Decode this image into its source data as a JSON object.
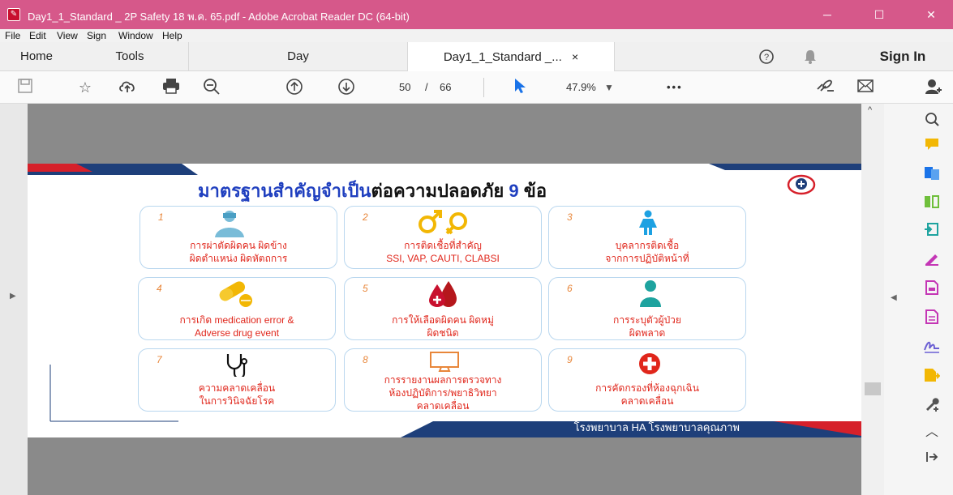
{
  "window": {
    "title": "Day1_1_Standard _ 2P Safety 18 พ.ค. 65.pdf - Adobe Acrobat Reader DC (64-bit)",
    "app_icon": "acrobat-icon",
    "controls": {
      "minimize": "─",
      "maximize": "☐",
      "close": "✕"
    }
  },
  "menu": [
    "File",
    "Edit",
    "View",
    "Sign",
    "Window",
    "Help"
  ],
  "tabs": {
    "home": "Home",
    "tools": "Tools",
    "doc1": "Day",
    "doc2": "Day1_1_Standard _...",
    "close": "×",
    "sign_in": "Sign In"
  },
  "toolbar": {
    "page_current": "50",
    "page_sep": "/",
    "page_total": "66",
    "zoom": "47.9%",
    "more": "•••"
  },
  "slide": {
    "title_blue": "มาตรฐานสำคัญจำเป็น",
    "title_black": "ต่อความปลอดภัย",
    "title_num": "9",
    "title_end": "ข้อ",
    "footer": "โรงพยาบาล HA โรงพยาบาลคุณภาพ",
    "cards": [
      {
        "num": "1",
        "line1": "การผ่าตัดผิดคน ผิดข้าง",
        "line2": "ผิดตำแหน่ง ผิดหัตถการ",
        "line3": ""
      },
      {
        "num": "2",
        "line1": "การติดเชื้อที่สำคัญ",
        "line2": "SSI, VAP, CAUTI, CLABSI",
        "line3": ""
      },
      {
        "num": "3",
        "line1": "บุคลากรติดเชื้อ",
        "line2": "จากการปฏิบัติหน้าที่",
        "line3": ""
      },
      {
        "num": "4",
        "line1": "การเกิด medication error &",
        "line2": "Adverse drug event",
        "line3": ""
      },
      {
        "num": "5",
        "line1": "การให้เลือดผิดคน ผิดหมู่",
        "line2": "ผิดชนิด",
        "line3": ""
      },
      {
        "num": "6",
        "line1": "การระบุตัวผู้ป่วย",
        "line2": "ผิดพลาด",
        "line3": ""
      },
      {
        "num": "7",
        "line1": "ความคลาดเคลื่อน",
        "line2": "ในการวินิจฉัยโรค",
        "line3": ""
      },
      {
        "num": "8",
        "line1": "การรายงานผลการตรวจทาง",
        "line2": "ห้องปฏิบัติการ/พยาธิวิทยา",
        "line3": "คลาดเคลื่อน"
      },
      {
        "num": "9",
        "line1": "การคัดกรองที่ห้องฉุกเฉิน",
        "line2": "คลาดเคลื่อน",
        "line3": ""
      }
    ]
  },
  "colors": {
    "titlebar": "#d6588a",
    "slide_blue": "#1f3fbf",
    "card_text_red": "#e0261b",
    "footer_navy": "#1e3f7a",
    "accent_red": "#d6202a"
  }
}
